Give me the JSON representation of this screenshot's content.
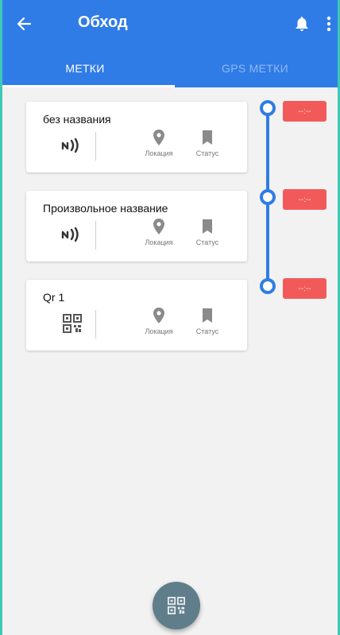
{
  "header": {
    "title": "Обход",
    "back_icon": "arrow-back-icon",
    "bell_icon": "bell-icon",
    "menu_icon": "more-vert-icon",
    "bg_color": "#2f7ce6"
  },
  "tabs": [
    {
      "label": "МЕТКИ",
      "active": true
    },
    {
      "label": "GPS МЕТКИ",
      "active": false
    }
  ],
  "checkpoints": [
    {
      "name": "без названия",
      "type_icon": "nfc-icon",
      "location_label": "Локация",
      "status_label": "Статус",
      "time": "--:--"
    },
    {
      "name": "Произвольное название",
      "type_icon": "nfc-icon",
      "location_label": "Локация",
      "status_label": "Статус",
      "time": "--:--"
    },
    {
      "name": "Qr 1",
      "type_icon": "qr-code-icon",
      "location_label": "Локация",
      "status_label": "Статус",
      "time": "--:--"
    }
  ],
  "fab": {
    "icon": "qr-code-icon"
  },
  "colors": {
    "accent": "#2f7ce6",
    "badge": "#f25a5a",
    "fab": "#607d8b"
  }
}
